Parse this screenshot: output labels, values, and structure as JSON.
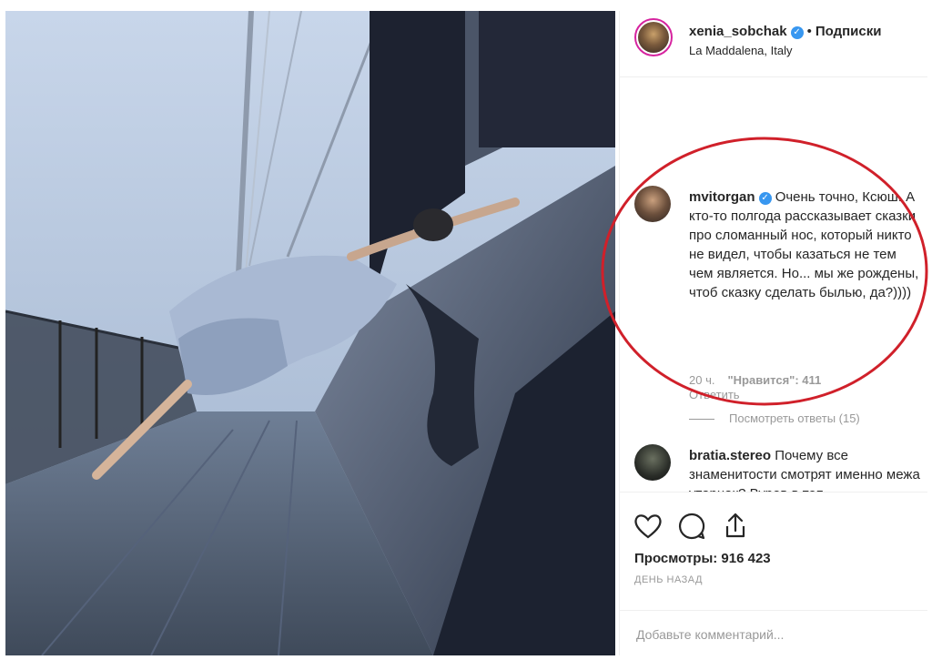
{
  "post": {
    "author": "xenia_sobchak",
    "follow_label": "Подписки",
    "location": "La Maddalena, Italy",
    "views_label": "Просмотры: 916 423",
    "time_ago": "ДЕНЬ НАЗАД",
    "comment_placeholder": "Добавьте комментарий..."
  },
  "comments": [
    {
      "user": "mvitorgan",
      "text": "Очень точно, Ксюш. А кто-то полгода рассказывает сказки про сломанный нос, который никто не видел, чтобы казаться не тем чем является. Но... мы же рождены, чтоб сказку сделать былью, да?))))",
      "time": "20 ч.",
      "likes": "\"Нравится\": 411",
      "reply_label": "Ответить",
      "show_replies": "Посмотреть ответы (15)"
    },
    {
      "user": "bratia.stereo",
      "text": "Почему все знаменитости смотрят именно межа утарнак? Вуров в топ"
    }
  ],
  "icons": {
    "like": "heart-icon",
    "comment": "comment-icon",
    "share": "share-icon",
    "verified": "verified-badge-icon"
  },
  "colors": {
    "accent": "#3897f0",
    "annotation": "#d0202a"
  }
}
